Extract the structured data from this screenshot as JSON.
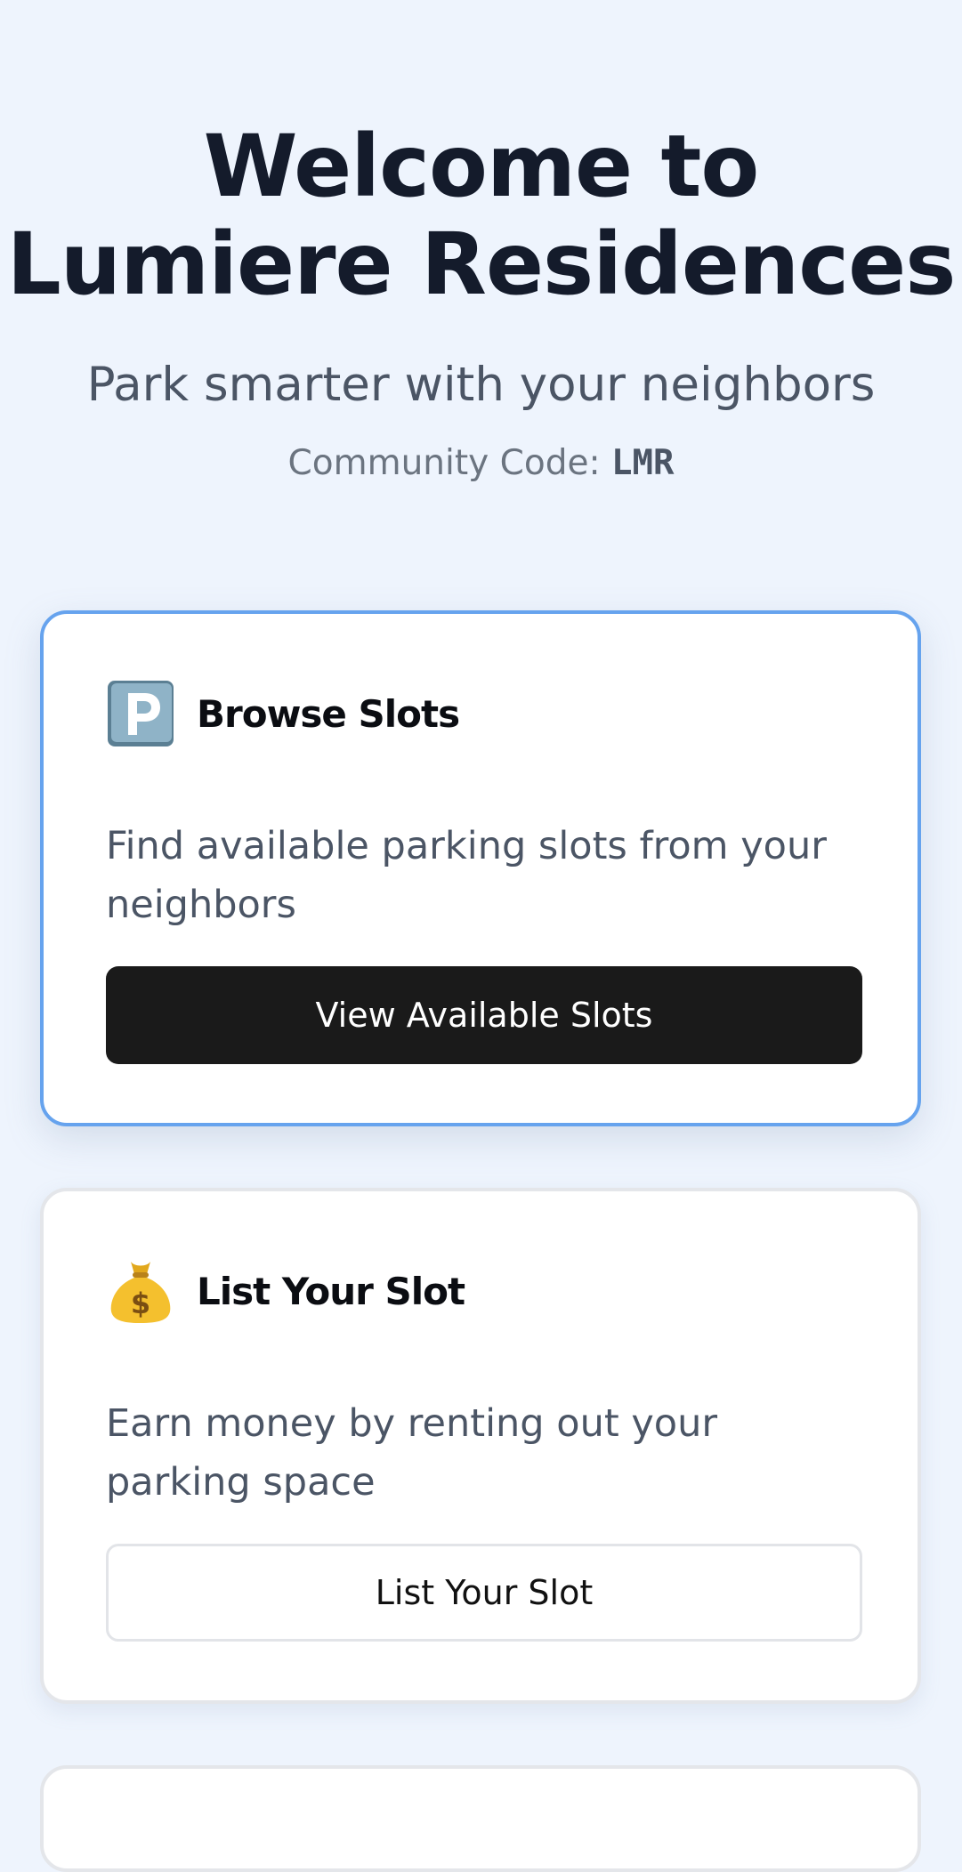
{
  "hero": {
    "title_line1": "Welcome to",
    "title_line2": "Lumiere Residences",
    "subtitle": "Park smarter with your neighbors",
    "community_code_label": "Community Code:",
    "community_code_value": "LMR"
  },
  "cards": [
    {
      "icon": "parking-icon",
      "title": "Browse Slots",
      "description": "Find available parking slots from your neighbors",
      "button_label": "View Available Slots"
    },
    {
      "icon": "money-bag-icon",
      "title": "List Your Slot",
      "description": "Earn money by renting out your parking space",
      "button_label": "List Your Slot"
    }
  ],
  "colors": {
    "background": "#eef4fd",
    "accent_border": "#66a3ee",
    "primary_button": "#1a1a1a"
  }
}
